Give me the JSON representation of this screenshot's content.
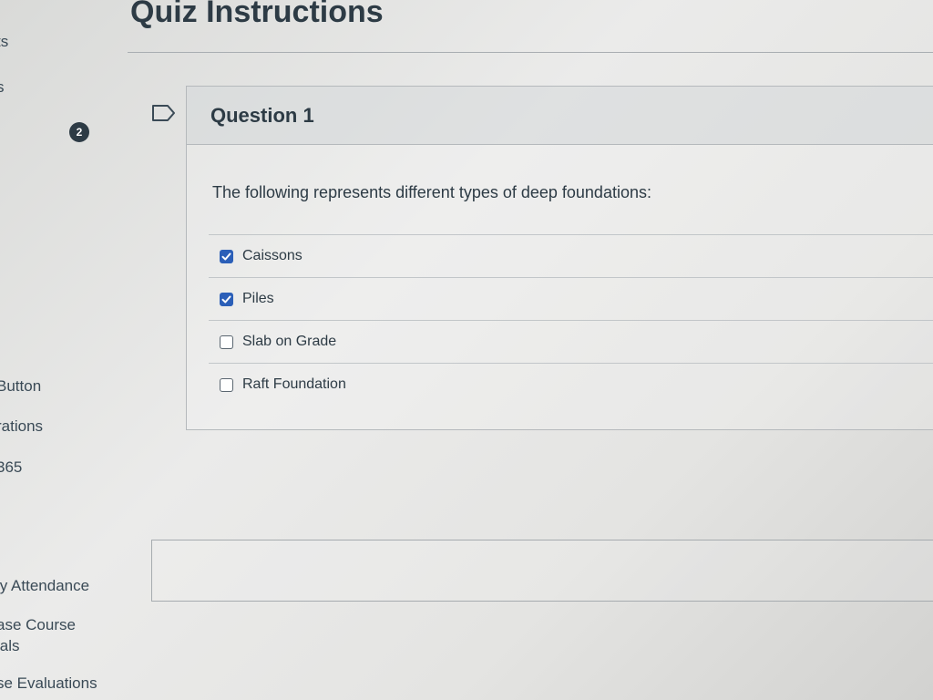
{
  "course_nav": {
    "items": [
      {
        "label": "ts"
      },
      {
        "label": "s"
      },
      {
        "label": "Button"
      },
      {
        "label": "rations"
      },
      {
        "label": "365"
      },
      {
        "label": "ly Attendance"
      },
      {
        "label": "ase Course"
      },
      {
        "label": "ials"
      },
      {
        "label": "se Evaluations"
      }
    ],
    "badge_count": "2"
  },
  "page": {
    "title": "Quiz Instructions"
  },
  "question": {
    "title": "Question 1",
    "prompt": "The following represents different types of deep foundations:",
    "flag_icon": "flag-outline-icon",
    "answers": [
      {
        "label": "Caissons",
        "checked": true
      },
      {
        "label": "Piles",
        "checked": true
      },
      {
        "label": "Slab on Grade",
        "checked": false
      },
      {
        "label": "Raft Foundation",
        "checked": false
      }
    ]
  },
  "colors": {
    "checkbox_checked": "#2b5fb8",
    "text": "#2d3b45"
  }
}
